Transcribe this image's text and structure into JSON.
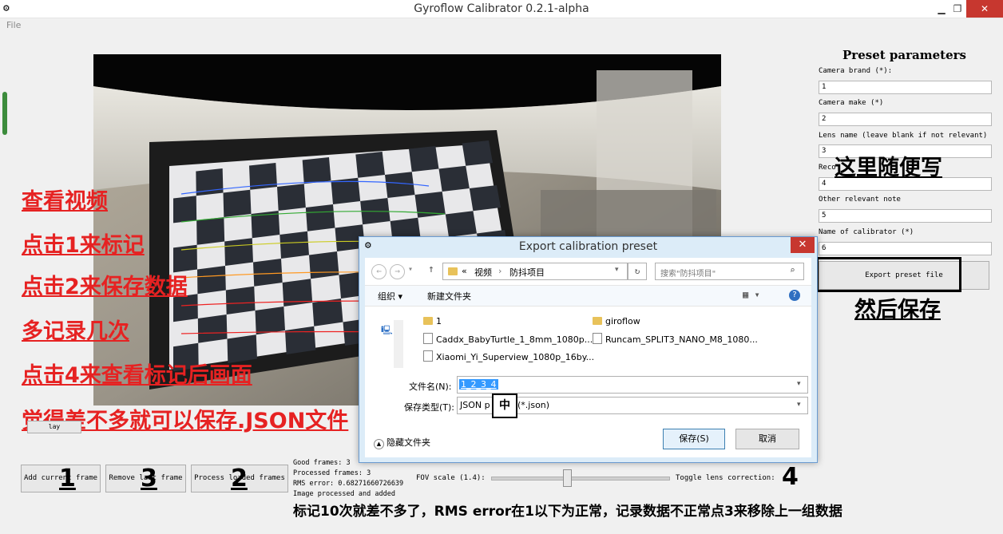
{
  "window": {
    "title": "Gyroflow Calibrator 0.2.1-alpha"
  },
  "menu": {
    "file": "File"
  },
  "preset": {
    "title": "Preset parameters",
    "fields": [
      {
        "label": "Camera brand (*):",
        "value": "1"
      },
      {
        "label": "Camera make (*)",
        "value": "2"
      },
      {
        "label": "Lens name (leave blank if not relevant)",
        "value": "3"
      },
      {
        "label": "Reco",
        "value": "4"
      },
      {
        "label": "Other relevant note",
        "value": "5"
      },
      {
        "label": "Name of calibrator (*)",
        "value": "6"
      }
    ],
    "export_button": "Export preset file"
  },
  "annotations": {
    "left_notes": [
      "查看视频",
      "点击1来标记",
      "点击2来保存数据",
      "多记录几次",
      "点击4来查看标记后画面",
      "觉得差不多就可以保存.JSON文件"
    ],
    "write_anything": "这里随便写",
    "then_save": "然后保存",
    "bottom_note": "标记10次就差不多了，RMS error在1以下为正常，记录数据不正常点3来移除上一组数据",
    "step_numbers": [
      "1",
      "3",
      "2",
      "4"
    ]
  },
  "controls": {
    "add_frame": "Add current frame",
    "remove_frame": "Remove last frame",
    "process_frames": "Process loaded frames",
    "play_fragment": "lay",
    "stats": [
      "Good frames: 3",
      "Processed frames: 3",
      "RMS error: 0.68271660726639",
      "Image processed and added"
    ],
    "fov_label": "FOV scale (1.4):",
    "fov_value": 0.43,
    "toggle_label": "Toggle lens correction:"
  },
  "dialog": {
    "title": "Export calibration preset",
    "close": "✕",
    "path_prefix": "«",
    "path": [
      "视频",
      "防抖项目"
    ],
    "search_placeholder": "搜索\"防抖项目\"",
    "organize": "组织 ▾",
    "new_folder": "新建文件夹",
    "files": [
      {
        "name": "1",
        "type": "folder"
      },
      {
        "name": "giroflow",
        "type": "folder"
      },
      {
        "name": "Caddx_BabyTurtle_1_8mm_1080p...",
        "type": "file"
      },
      {
        "name": "Runcam_SPLIT3_NANO_M8_1080...",
        "type": "file"
      },
      {
        "name": "Xiaomi_Yi_Superview_1080p_16by...",
        "type": "file"
      }
    ],
    "filename_label": "文件名(N):",
    "filename_value": "1_2_3_4",
    "filetype_label": "保存类型(T):",
    "filetype_left": "JSON p",
    "filetype_right": "(*.json)",
    "ime_char": "中",
    "hide_folders": "隐藏文件夹",
    "save": "保存(S)",
    "cancel": "取消"
  },
  "colors": {
    "accent_red": "#e62222",
    "close_red": "#c7372f",
    "dialog_bg": "#dcecf8",
    "selection_blue": "#3399ff"
  }
}
